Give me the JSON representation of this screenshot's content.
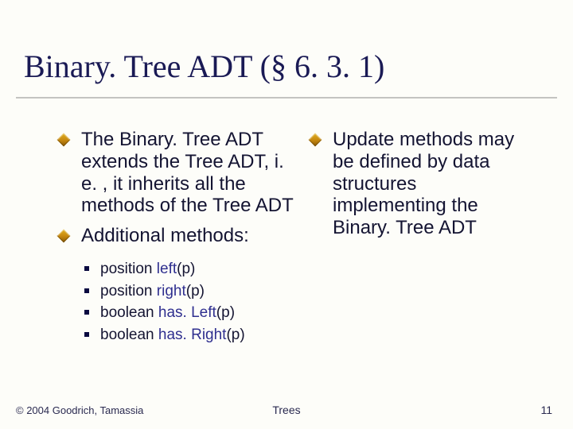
{
  "title": "Binary. Tree ADT (§ 6. 3. 1)",
  "left": {
    "b1": "The Binary. Tree ADT extends the Tree ADT, i. e. , it inherits all the methods of the Tree ADT",
    "b2": "Additional methods:",
    "methods": [
      {
        "ret": "position ",
        "name": "left",
        "arg": "(p)"
      },
      {
        "ret": "position ",
        "name": "right",
        "arg": "(p)"
      },
      {
        "ret": "boolean ",
        "name": "has. Left",
        "arg": "(p)"
      },
      {
        "ret": "boolean ",
        "name": "has. Right",
        "arg": "(p)"
      }
    ]
  },
  "right": {
    "b1": "Update methods may be defined by data structures implementing the Binary. Tree ADT"
  },
  "footer": {
    "copyright": "© 2004 Goodrich, Tamassia",
    "center": "Trees",
    "page": "11"
  }
}
